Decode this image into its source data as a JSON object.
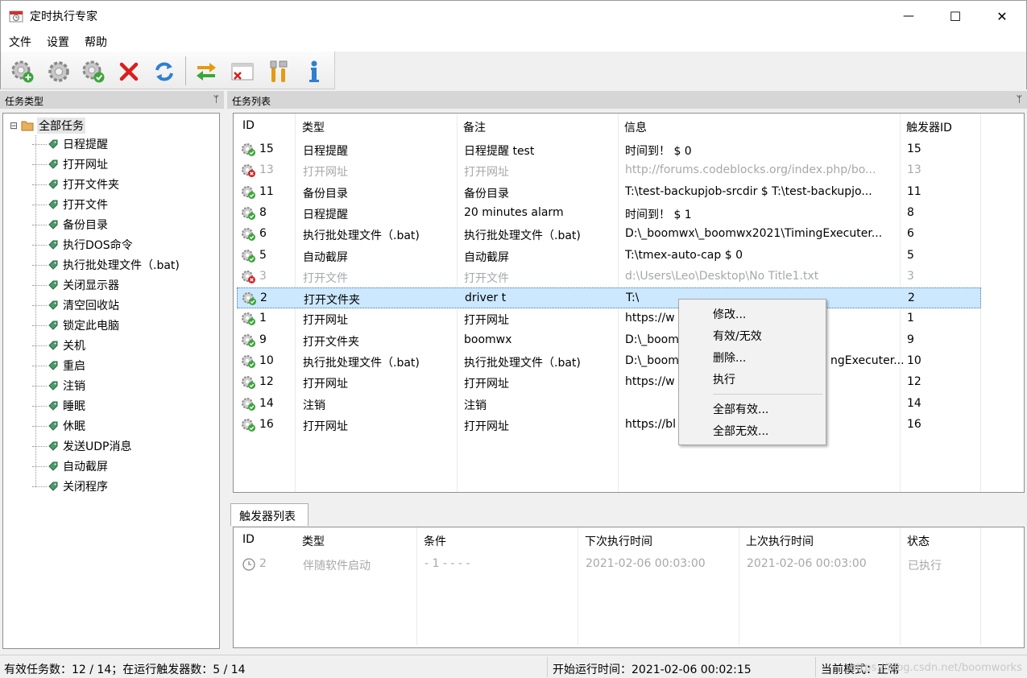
{
  "window": {
    "title": "定时执行专家",
    "minimize_glyph": "—",
    "maximize_glyph": "☐",
    "close_glyph": "✕"
  },
  "menu": [
    "文件",
    "设置",
    "帮助"
  ],
  "toolbar": {
    "buttons": [
      "add-task-icon",
      "settings-gear-icon",
      "enable-task-icon",
      "delete-icon",
      "refresh-icon",
      "switch-icon",
      "close-window-icon",
      "tools-icon",
      "info-icon"
    ]
  },
  "left_panel": {
    "title": "任务类型",
    "pin": "ᛘ",
    "root": "全部任务",
    "expander": "⊟",
    "items": [
      "日程提醒",
      "打开网址",
      "打开文件夹",
      "打开文件",
      "备份目录",
      "执行DOS命令",
      "执行批处理文件（.bat)",
      "关闭显示器",
      "清空回收站",
      "锁定此电脑",
      "关机",
      "重启",
      "注销",
      "睡眠",
      "休眠",
      "发送UDP消息",
      "自动截屏",
      "关闭程序"
    ]
  },
  "task_panel": {
    "title": "任务列表",
    "pin": "ᛘ",
    "columns": [
      "ID",
      "类型",
      "备注",
      "信息",
      "触发器ID"
    ],
    "rows": [
      {
        "id": "15",
        "type": "日程提醒",
        "note": "日程提醒 test",
        "info": "时间到！ $ 0",
        "trigger": "15",
        "enabled": true
      },
      {
        "id": "13",
        "type": "打开网址",
        "note": "打开网址",
        "info": "http://forums.codeblocks.org/index.php/bo...",
        "trigger": "13",
        "enabled": false
      },
      {
        "id": "11",
        "type": "备份目录",
        "note": "备份目录",
        "info": "T:\\test-backupjob-srcdir $ T:\\test-backupjo...",
        "trigger": "11",
        "enabled": true
      },
      {
        "id": "8",
        "type": "日程提醒",
        "note": "20 minutes alarm",
        "info": "时间到！ $ 1",
        "trigger": "8",
        "enabled": true
      },
      {
        "id": "6",
        "type": "执行批处理文件（.bat)",
        "note": "执行批处理文件（.bat)",
        "info": "D:\\_boomwx\\_boomwx2021\\TimingExecuter...",
        "trigger": "6",
        "enabled": true
      },
      {
        "id": "5",
        "type": "自动截屏",
        "note": "自动截屏",
        "info": "T:\\tmex-auto-cap $ 0",
        "trigger": "5",
        "enabled": true
      },
      {
        "id": "3",
        "type": "打开文件",
        "note": "打开文件",
        "info": "d:\\Users\\Leo\\Desktop\\No Title1.txt",
        "trigger": "3",
        "enabled": false
      },
      {
        "id": "2",
        "type": "打开文件夹",
        "note": "driver t",
        "info": "T:\\",
        "trigger": "2",
        "enabled": true,
        "selected": true
      },
      {
        "id": "1",
        "type": "打开网址",
        "note": "打开网址",
        "info": "https://w",
        "trigger": "1",
        "enabled": true
      },
      {
        "id": "9",
        "type": "打开文件夹",
        "note": "boomwx",
        "info": "D:\\_boom",
        "trigger": "9",
        "enabled": true
      },
      {
        "id": "10",
        "type": "执行批处理文件（.bat)",
        "note": "执行批处理文件（.bat)",
        "info": "D:\\_boom",
        "info_tail": "ngExecuter...",
        "trigger": "10",
        "enabled": true
      },
      {
        "id": "12",
        "type": "打开网址",
        "note": "打开网址",
        "info": "https://w",
        "trigger": "12",
        "enabled": true
      },
      {
        "id": "14",
        "type": "注销",
        "note": "注销",
        "info": "",
        "trigger": "14",
        "enabled": true
      },
      {
        "id": "16",
        "type": "打开网址",
        "note": "打开网址",
        "info": "https://bl",
        "trigger": "16",
        "enabled": true
      }
    ]
  },
  "context_menu": {
    "items": [
      "修改...",
      "有效/无效",
      "删除...",
      "执行"
    ],
    "items2": [
      "全部有效...",
      "全部无效..."
    ]
  },
  "trigger_panel": {
    "tab": "触发器列表",
    "columns": [
      "ID",
      "类型",
      "条件",
      "下次执行时间",
      "上次执行时间",
      "状态"
    ],
    "rows": [
      {
        "id": "2",
        "type": "伴随软件启动",
        "condition": "- 1 - - - -",
        "next": "2021-02-06 00:03:00",
        "last": "2021-02-06 00:03:00",
        "status": "已执行"
      }
    ]
  },
  "status_bar": {
    "left": "有效任务数：12 / 14；在运行触发器数：5 / 14",
    "middle": "开始运行时间：2021-02-06 00:02:15",
    "right": "当前模式：正常",
    "watermark": "https://blog.csdn.net/boomworks"
  },
  "colors": {
    "selection": "#cce8ff",
    "disabled_text": "#a8a8a8",
    "delete_red": "#d81e1e",
    "ok_green": "#3aa63a"
  }
}
